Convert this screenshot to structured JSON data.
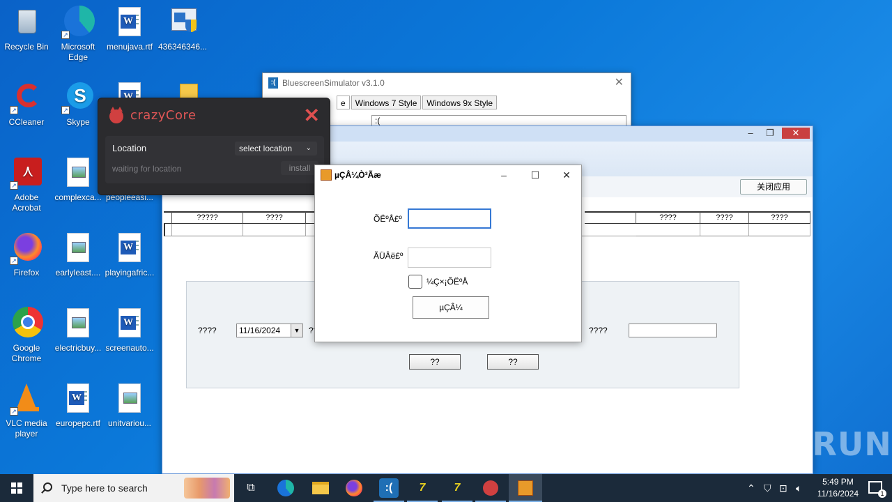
{
  "desktop": {
    "icons": [
      {
        "label": "Recycle Bin"
      },
      {
        "label": "Microsoft Edge"
      },
      {
        "label": "menujava.rtf"
      },
      {
        "label": "436346346..."
      },
      {
        "label": "CCleaner"
      },
      {
        "label": "Skype"
      },
      {
        "label": "Adobe Acrobat"
      },
      {
        "label": "complexca..."
      },
      {
        "label": "peopleeasi..."
      },
      {
        "label": "Firefox"
      },
      {
        "label": "earlyleast...."
      },
      {
        "label": "playingafric..."
      },
      {
        "label": "Google Chrome"
      },
      {
        "label": "electricbuy..."
      },
      {
        "label": "screenauto..."
      },
      {
        "label": "VLC media player"
      },
      {
        "label": "europepc.rtf"
      },
      {
        "label": "unitvariou..."
      }
    ]
  },
  "bluescreen": {
    "title": "BluescreenSimulator v3.1.0",
    "tabs": [
      "e",
      "Windows 7 Style",
      "Windows 9x Style"
    ],
    "field_value": ":("
  },
  "app": {
    "close_app_label": "关闭应用",
    "grid_headers": [
      "?????",
      "????",
      "????",
      "????",
      "????"
    ],
    "form": {
      "label_left": "????",
      "date_value": "11/16/2024",
      "label_mid": "??",
      "label_right": "????",
      "btn1": "??",
      "btn2": "??"
    }
  },
  "crazycore": {
    "name": "crazyCore",
    "location_label": "Location",
    "select_label": "select location",
    "status": "waiting for location",
    "install_label": "install"
  },
  "login_dialog": {
    "title": "µÇÂ¼Ò³Ãæ",
    "username_label": "ÕËºÅ£º",
    "password_label": "ÃÜÂë£º",
    "remember_label": "¼Ç×¡ÕËºÅ",
    "login_button": "µÇÂ¼"
  },
  "watermark": "ANY RUN",
  "taskbar": {
    "search_placeholder": "Type here to search",
    "time": "5:49 PM",
    "date": "11/16/2024",
    "notification_count": "1"
  }
}
